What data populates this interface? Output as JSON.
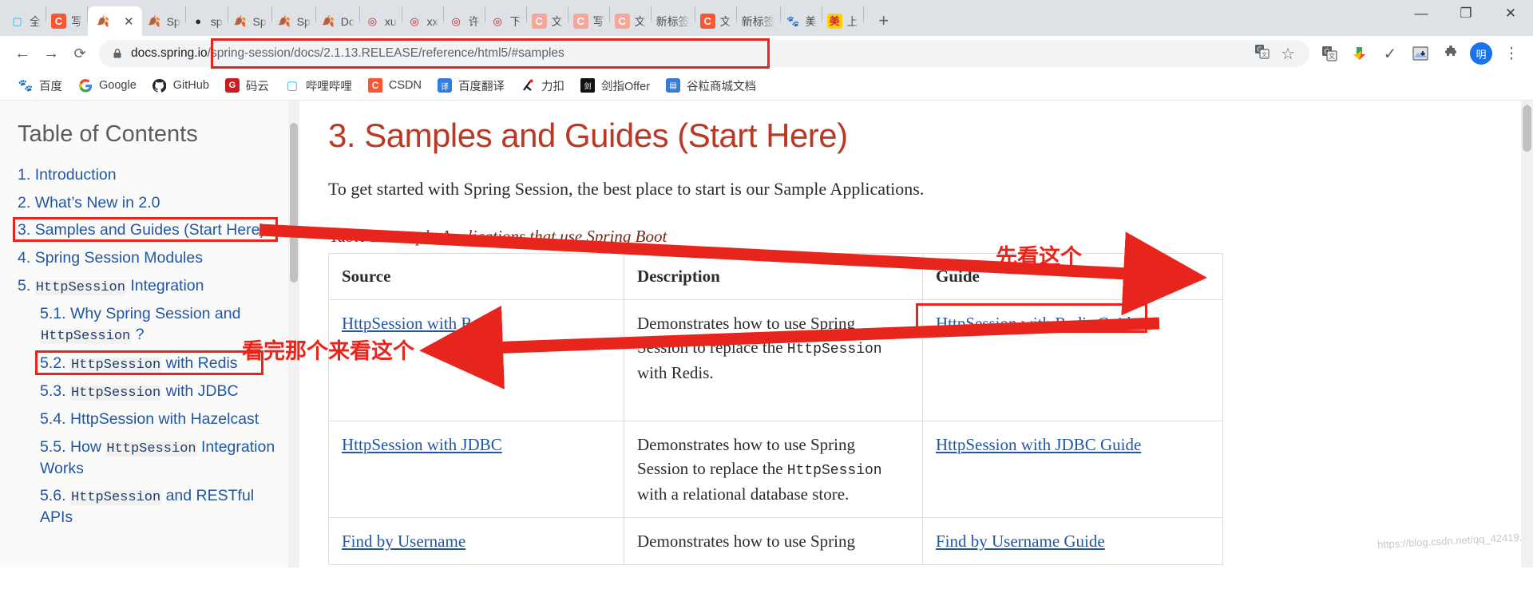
{
  "window": {
    "minimize_label": "—",
    "maximize_label": "❐",
    "close_label": "✕",
    "new_tab_label": "+"
  },
  "tabs": [
    {
      "label": "全",
      "icon": "bilibili-icon",
      "active": false
    },
    {
      "label": "写",
      "icon": "csdn-icon",
      "active": false
    },
    {
      "label": "",
      "icon": "spring-icon",
      "active": true,
      "close_label": "✕"
    },
    {
      "label": "Sp",
      "icon": "spring-icon",
      "active": false
    },
    {
      "label": "sp",
      "icon": "github-icon",
      "active": false
    },
    {
      "label": "Sp",
      "icon": "spring-icon",
      "active": false
    },
    {
      "label": "Sp",
      "icon": "spring-icon",
      "active": false
    },
    {
      "label": "Dc",
      "icon": "spring-icon",
      "active": false
    },
    {
      "label": "xu",
      "icon": "gitee-icon",
      "active": false
    },
    {
      "label": "xx",
      "icon": "gitee-icon",
      "active": false
    },
    {
      "label": "许",
      "icon": "gitee-icon",
      "active": false
    },
    {
      "label": "下",
      "icon": "gitee-icon",
      "active": false
    },
    {
      "label": "文",
      "icon": "csdn-pale-icon",
      "active": false
    },
    {
      "label": "写",
      "icon": "csdn-pale-icon",
      "active": false
    },
    {
      "label": "文",
      "icon": "csdn-pale-icon",
      "active": false
    },
    {
      "label": "新标签",
      "icon": "none",
      "active": false
    },
    {
      "label": "文",
      "icon": "csdn-icon",
      "active": false
    },
    {
      "label": "新标签",
      "icon": "none",
      "active": false
    },
    {
      "label": "美",
      "icon": "baidu-icon",
      "active": false
    },
    {
      "label": "上",
      "icon": "meituan-icon",
      "active": false
    }
  ],
  "toolbar": {
    "back_label": "←",
    "forward_label": "→",
    "reload_label": "⟳",
    "url_scheme_host": "docs.spring.io",
    "url_path": "/spring-session/docs/2.1.13.RELEASE/reference/html5/#samples",
    "url_full": "docs.spring.io/spring-session/docs/2.1.13.RELEASE/reference/html5/#samples",
    "translate_label": "G",
    "bookmark_star_label": "☆",
    "profile_initial": "明",
    "menu_label": "⋮"
  },
  "bookmarks": [
    {
      "label": "百度",
      "icon": "baidu-icon"
    },
    {
      "label": "Google",
      "icon": "google-icon"
    },
    {
      "label": "GitHub",
      "icon": "github-icon"
    },
    {
      "label": "码云",
      "icon": "gitee-icon"
    },
    {
      "label": "哔哩哔哩",
      "icon": "bilibili-icon"
    },
    {
      "label": "CSDN",
      "icon": "csdn-icon"
    },
    {
      "label": "百度翻译",
      "icon": "fanyi-icon"
    },
    {
      "label": "力扣",
      "icon": "leetcode-icon"
    },
    {
      "label": "剑指Offer",
      "icon": "offer-icon"
    },
    {
      "label": "谷粒商城文档",
      "icon": "docs-icon"
    }
  ],
  "toc": {
    "title": "Table of Contents",
    "items": [
      {
        "num": "1.",
        "text": "Introduction",
        "level": 1,
        "mono_parts": []
      },
      {
        "num": "2.",
        "text": "What’s New in 2.0",
        "level": 1,
        "mono_parts": []
      },
      {
        "num": "3.",
        "text": "Samples and Guides (Start Here)",
        "level": 1,
        "highlighted": true
      },
      {
        "num": "4.",
        "text": "Spring Session Modules",
        "level": 1
      },
      {
        "num": "5.",
        "text": "HttpSession Integration",
        "level": 1,
        "mono": "HttpSession",
        "after": " Integration"
      },
      {
        "num": "5.1.",
        "text": "Why Spring Session and HttpSession ?",
        "level": 2
      },
      {
        "num": "5.2.",
        "text": "HttpSession with Redis",
        "level": 2,
        "highlighted": true
      },
      {
        "num": "5.3.",
        "text": "HttpSession with JDBC",
        "level": 2
      },
      {
        "num": "5.4.",
        "text": "HttpSession with Hazelcast",
        "level": 2
      },
      {
        "num": "5.5.",
        "text": "How HttpSession Integration Works",
        "level": 2
      },
      {
        "num": "5.6.",
        "text": "HttpSession and RESTful APIs",
        "level": 2
      }
    ]
  },
  "content": {
    "heading": "3. Samples and Guides (Start Here)",
    "intro": "To get started with Spring Session, the best place to start is our Sample Applications.",
    "table_caption": "Table 1. Sample Applications that use Spring Boot",
    "columns": [
      "Source",
      "Description",
      "Guide"
    ],
    "rows": [
      {
        "source": "HttpSession with Redis",
        "description_pre": "Demonstrates how to use Spring Session to replace the ",
        "description_mono": "HttpSession",
        "description_post": " with Redis.",
        "guide": "HttpSession with Redis Guide",
        "guide_highlighted": true
      },
      {
        "source": "HttpSession with JDBC",
        "description_pre": "Demonstrates how to use Spring Session to replace the ",
        "description_mono": "HttpSession",
        "description_post": " with a relational database store.",
        "guide": "HttpSession with JDBC Guide",
        "guide_highlighted": false
      },
      {
        "source": "Find by Username",
        "description_pre": "Demonstrates how to use Spring",
        "description_mono": "",
        "description_post": "",
        "guide": "Find by Username Guide",
        "guide_highlighted": false
      }
    ]
  },
  "annotations": {
    "guide_note": "先看这个",
    "toc_note": "看完那个来看这个",
    "color": "#e8251c",
    "watermark": "https://blog.csdn.net/qq_42419... "
  }
}
